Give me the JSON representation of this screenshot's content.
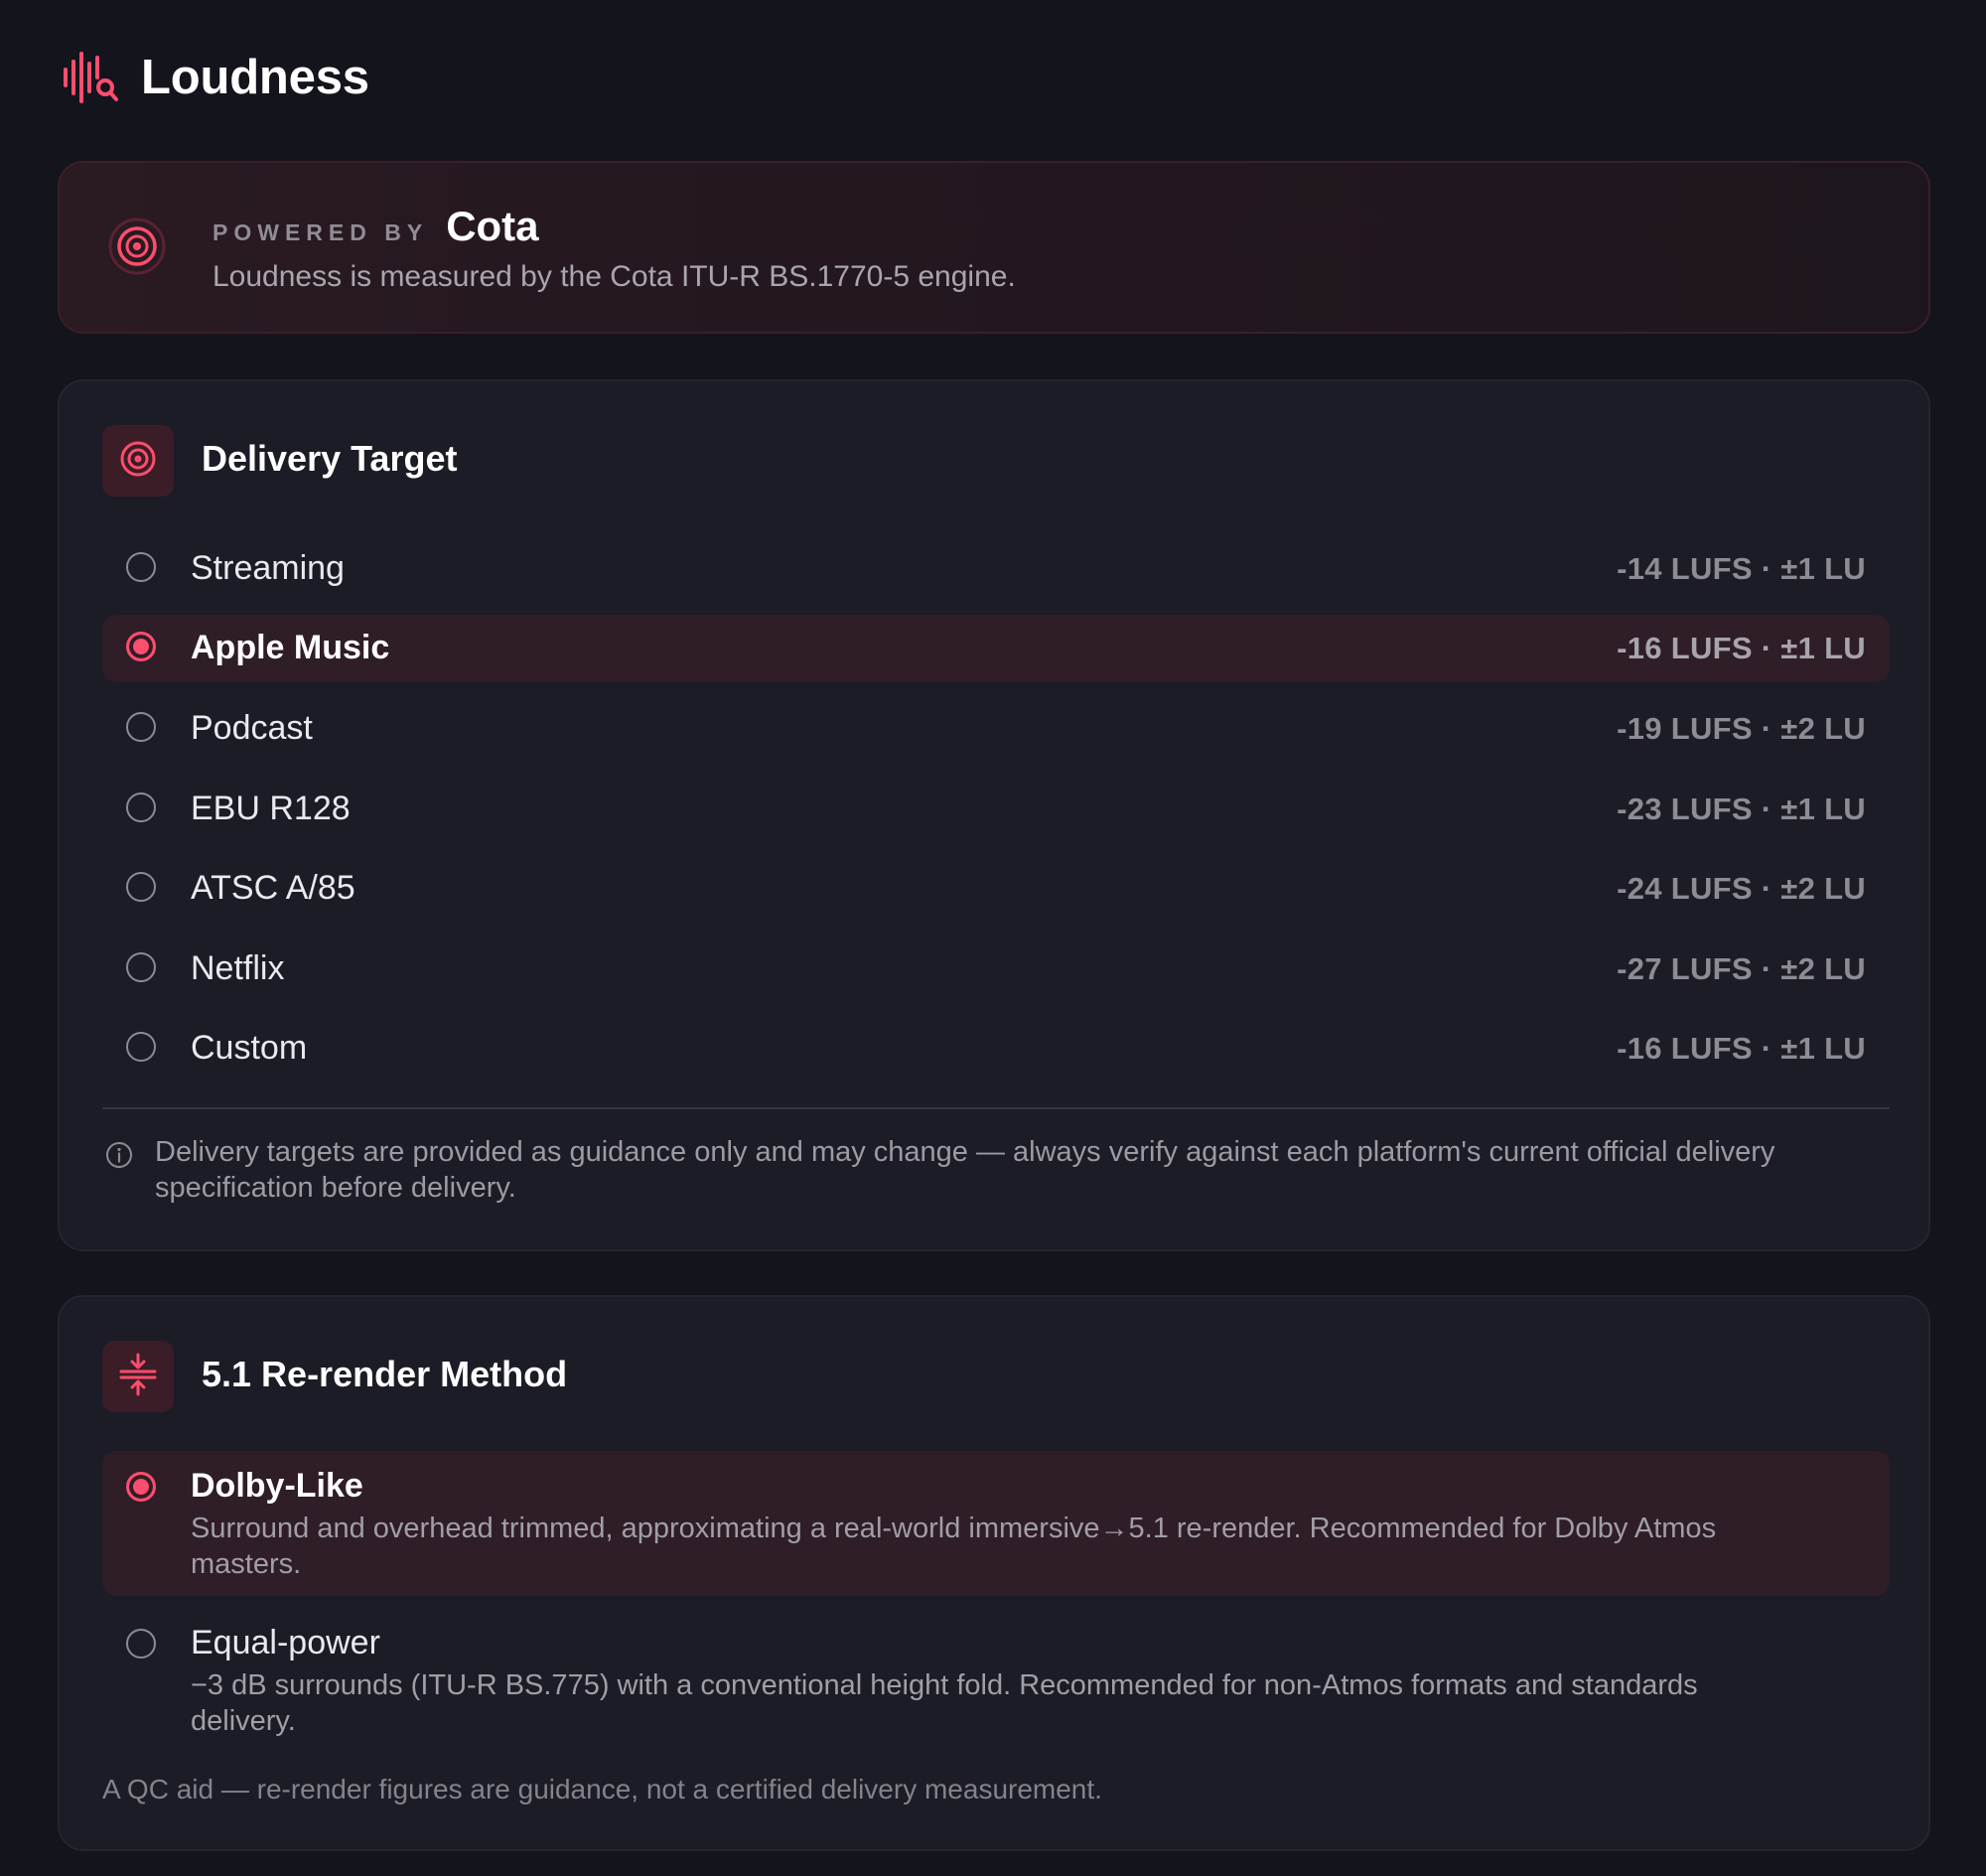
{
  "header": {
    "title": "Loudness",
    "icon": "waveform-search-icon"
  },
  "powered": {
    "label": "POWERED BY",
    "brand": "Cota",
    "description": "Loudness is measured by the Cota ITU-R BS.1770-5 engine.",
    "icon": "target-icon"
  },
  "delivery": {
    "title": "Delivery Target",
    "icon": "target-icon",
    "options": [
      {
        "label": "Streaming",
        "value": "-14 LUFS · ±1 LU",
        "selected": false
      },
      {
        "label": "Apple Music",
        "value": "-16 LUFS · ±1 LU",
        "selected": true
      },
      {
        "label": "Podcast",
        "value": "-19 LUFS · ±2 LU",
        "selected": false
      },
      {
        "label": "EBU R128",
        "value": "-23 LUFS · ±1 LU",
        "selected": false
      },
      {
        "label": "ATSC A/85",
        "value": "-24 LUFS · ±2 LU",
        "selected": false
      },
      {
        "label": "Netflix",
        "value": "-27 LUFS · ±2 LU",
        "selected": false
      },
      {
        "label": "Custom",
        "value": "-16 LUFS · ±1 LU",
        "selected": false
      }
    ],
    "note": "Delivery targets are provided as guidance only and may change — always verify against each platform's current official delivery specification before delivery.",
    "note_icon": "info-icon"
  },
  "rerender": {
    "title": "5.1 Re-render Method",
    "icon": "fold-arrows-icon",
    "options": [
      {
        "label": "Dolby-Like",
        "description": "Surround and overhead trimmed, approximating a real-world immersive→5.1 re-render. Recommended for Dolby Atmos masters.",
        "selected": true
      },
      {
        "label": "Equal-power",
        "description": "−3 dB surrounds (ITU-R BS.775) with a conventional height fold. Recommended for non-Atmos formats and standards delivery.",
        "selected": false
      }
    ],
    "footer": "A QC aid — re-render figures are guidance, not a certified delivery measurement."
  },
  "colors": {
    "accent": "#ff4d6d",
    "background": "#13141c",
    "card": "#1b1c26",
    "selected_row": "#2f1d27"
  }
}
